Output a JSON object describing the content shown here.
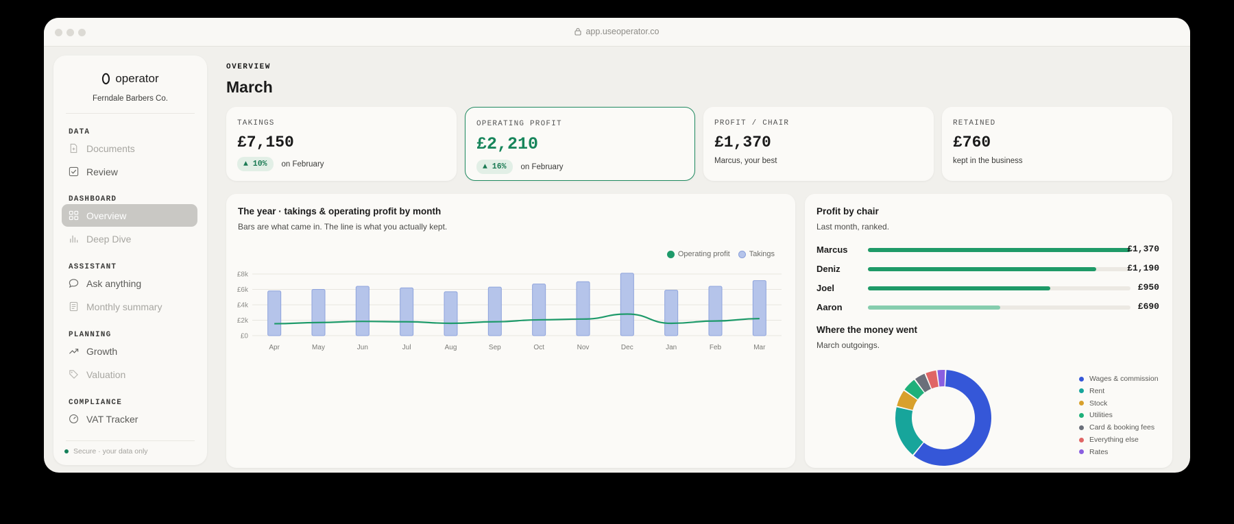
{
  "browser": {
    "url": "app.useoperator.co"
  },
  "sidebar": {
    "brand": "operator",
    "company": "Ferndale Barbers Co.",
    "sections": {
      "data": "DATA",
      "dashboard": "DASHBOARD",
      "assistant": "ASSISTANT",
      "planning": "PLANNING",
      "compliance": "COMPLIANCE"
    },
    "items": {
      "documents": "Documents",
      "review": "Review",
      "overview": "Overview",
      "deep_dive": "Deep Dive",
      "ask_anything": "Ask anything",
      "monthly_summary": "Monthly summary",
      "growth": "Growth",
      "valuation": "Valuation",
      "vat_tracker": "VAT Tracker"
    },
    "secure": "Secure · your data only"
  },
  "header": {
    "eyebrow": "OVERVIEW",
    "title": "March"
  },
  "kpis": [
    {
      "label": "TAKINGS",
      "value": "£7,150",
      "badge": "▲ 10%",
      "note": "on February"
    },
    {
      "label": "OPERATING PROFIT",
      "value": "£2,210",
      "badge": "▲ 16%",
      "note": "on February"
    },
    {
      "label": "PROFIT / CHAIR",
      "value": "£1,370",
      "note": "Marcus, your best"
    },
    {
      "label": "RETAINED",
      "value": "£760",
      "note": "kept in the business"
    }
  ],
  "year_card": {
    "title": "The year · takings & operating profit by month",
    "subtitle": "Bars are what came in. The line is what you actually kept."
  },
  "chairs_card": {
    "title": "Profit by chair",
    "subtitle": "Last month, ranked.",
    "rows": [
      {
        "name": "Marcus",
        "value": "£1,370",
        "amount": 1370
      },
      {
        "name": "Deniz",
        "value": "£1,190",
        "amount": 1190
      },
      {
        "name": "Joel",
        "value": "£950",
        "amount": 950
      },
      {
        "name": "Aaron",
        "value": "£690",
        "amount": 690
      }
    ],
    "colors": {
      "primary": "#1f9a68",
      "muted": "#86cdae"
    }
  },
  "money_card": {
    "title": "Where the money went",
    "subtitle": "March outgoings."
  },
  "chart_data": [
    {
      "type": "bar",
      "categories": [
        "Apr",
        "May",
        "Jun",
        "Jul",
        "Aug",
        "Sep",
        "Oct",
        "Nov",
        "Dec",
        "Jan",
        "Feb",
        "Mar"
      ],
      "series": [
        {
          "name": "Takings",
          "type": "bar",
          "color": "#b5c4ea",
          "values": [
            5800,
            6000,
            6400,
            6200,
            5700,
            6300,
            6700,
            7000,
            8100,
            5900,
            6400,
            7150
          ]
        },
        {
          "name": "Operating profit",
          "type": "line",
          "color": "#1e9a6a",
          "values": [
            1550,
            1700,
            1850,
            1800,
            1600,
            1800,
            2050,
            2150,
            2800,
            1600,
            1900,
            2210
          ]
        }
      ],
      "y_ticks": [
        "£0",
        "£2k",
        "£4k",
        "£6k",
        "£8k"
      ],
      "ylim": [
        0,
        8000
      ],
      "grid": true,
      "legend": "top-right"
    },
    {
      "type": "pie",
      "labels": [
        "Wages & commission",
        "Rent",
        "Stock",
        "Utilities",
        "Card & booking fees",
        "Everything else",
        "Rates"
      ],
      "values": [
        60,
        18,
        6,
        5,
        4,
        4,
        3
      ],
      "colors": [
        "#3557d8",
        "#17a59b",
        "#d8a02c",
        "#1fb07a",
        "#6b6f7a",
        "#e06565",
        "#8a5fe0"
      ],
      "legend": "right"
    }
  ]
}
